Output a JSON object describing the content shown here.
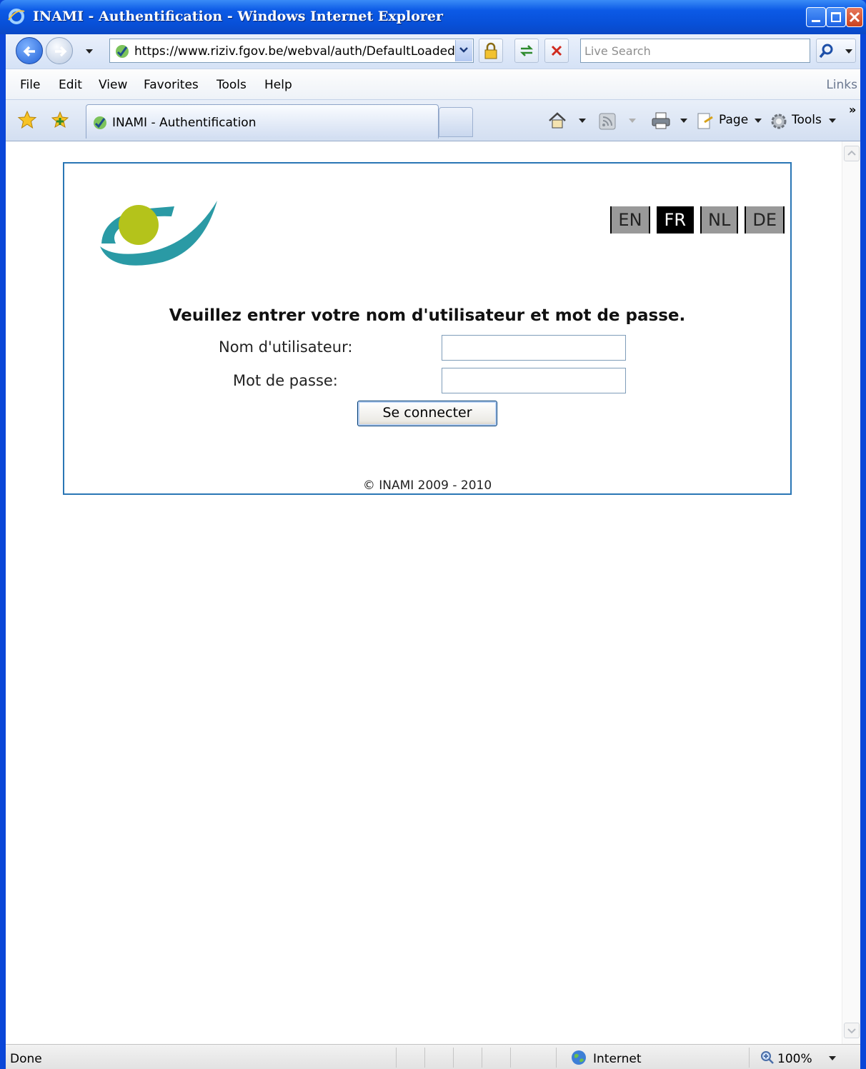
{
  "window": {
    "title": "INAMI - Authentification - Windows Internet Explorer"
  },
  "addressbar": {
    "url": "https://www.riziv.fgov.be/webval/auth/DefaultLoaded.",
    "search_placeholder": "Live Search"
  },
  "menubar": {
    "items": [
      "File",
      "Edit",
      "View",
      "Favorites",
      "Tools",
      "Help"
    ],
    "links_label": "Links"
  },
  "tabbar": {
    "active_tab": "INAMI - Authentification",
    "page_label": "Page",
    "tools_label": "Tools"
  },
  "page": {
    "languages": [
      {
        "code": "EN",
        "active": false
      },
      {
        "code": "FR",
        "active": true
      },
      {
        "code": "NL",
        "active": false
      },
      {
        "code": "DE",
        "active": false
      }
    ],
    "heading": "Veuillez entrer votre nom d'utilisateur et mot de passe.",
    "username_label": "Nom d'utilisateur:",
    "username_value": "",
    "password_label": "Mot de passe:",
    "password_value": "",
    "submit_label": "Se connecter",
    "copyright": "© INAMI 2009 - 2010",
    "logo_colors": {
      "teal": "#2a9aa5",
      "green": "#b4c31b"
    }
  },
  "statusbar": {
    "status": "Done",
    "zone": "Internet",
    "zoom": "100%"
  }
}
